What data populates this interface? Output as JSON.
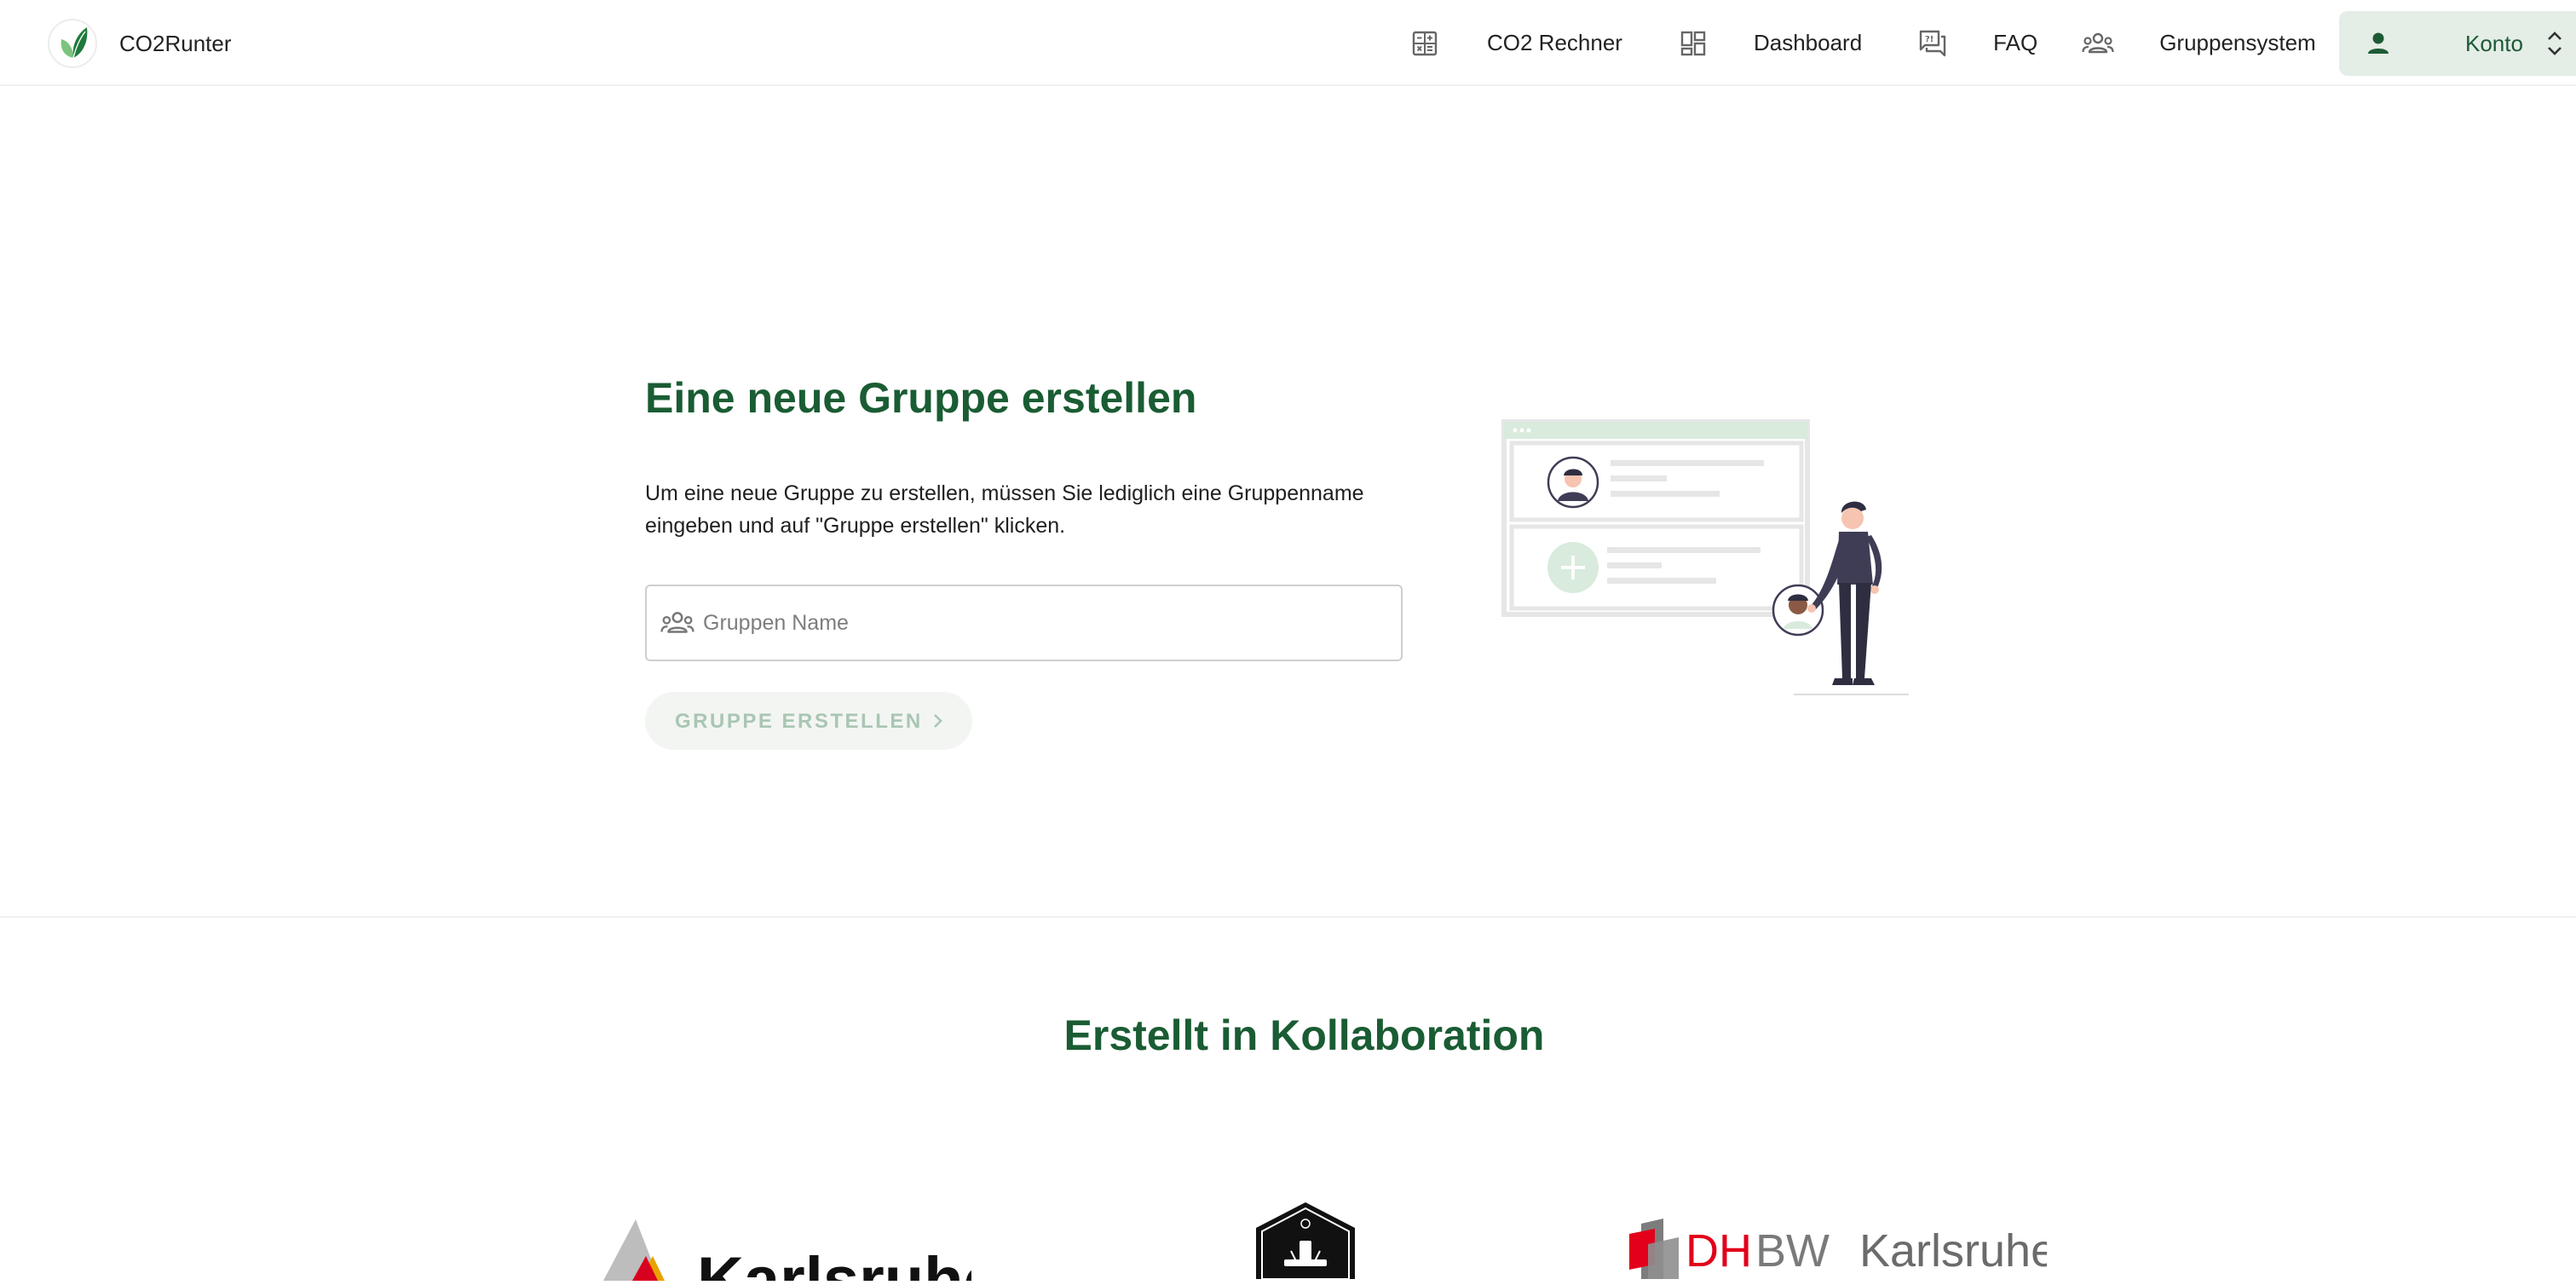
{
  "app": {
    "name": "CO2Runter"
  },
  "nav": {
    "items": [
      {
        "label": "CO2 Rechner",
        "icon": "calculator-icon"
      },
      {
        "label": "Dashboard",
        "icon": "dashboard-icon"
      },
      {
        "label": "FAQ",
        "icon": "faq-icon"
      },
      {
        "label": "Gruppensystem",
        "icon": "groups-icon"
      }
    ],
    "account": {
      "label": "Konto",
      "icon": "person-icon",
      "trailing_icon": "unfold-icon"
    }
  },
  "main": {
    "title": "Eine neue Gruppe erstellen",
    "description": "Um eine neue Gruppe zu erstellen, müssen Sie lediglich eine Gruppenname eingeben und auf \"Gruppe erstellen\" klicken.",
    "group_name_input": {
      "value": "",
      "placeholder": "Gruppen Name",
      "icon": "groups-icon"
    },
    "create_button": {
      "label": "GRUPPE ERSTELLEN",
      "icon": "chevron-right-icon",
      "disabled": true
    }
  },
  "collaboration": {
    "title": "Erstellt in Kollaboration",
    "partners": [
      {
        "name": "Karlsruhe"
      },
      {
        "name": "emblem"
      },
      {
        "name": "DHBW Karlsruhe"
      }
    ]
  },
  "colors": {
    "brand_green": "#1a5c33",
    "account_bg": "#e4ede6",
    "button_disabled_bg": "#f3f5f3",
    "button_disabled_text": "#a9c6b3",
    "dhbw_red": "#e2001a"
  }
}
